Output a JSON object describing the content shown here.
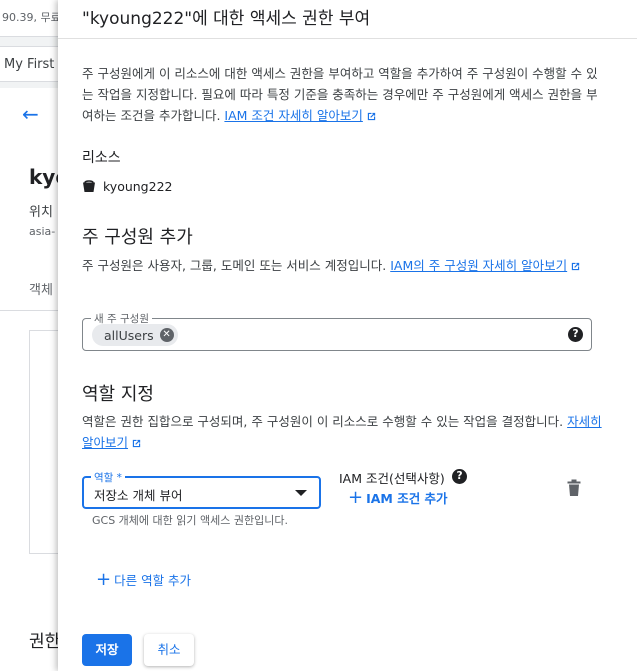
{
  "background": {
    "topbar_text": "90.39, 무료",
    "project_selector": "My First",
    "bucket_name": "kyo",
    "location_label": "위치",
    "location_value": "asia-",
    "objects_tab": "객체",
    "permissions_heading": "권한"
  },
  "panel": {
    "title": "\"kyoung222\"에 대한 액세스 권한 부여",
    "intro_text": "주 구성원에게 이 리소스에 대한 액세스 권한을 부여하고 역할을 추가하여 주 구성원이 수행할 수 있는 작업을 지정합니다. 필요에 따라 특정 기준을 충족하는 경우에만 주 구성원에게 액세스 권한을 부여하는 조건을 추가합니다.",
    "intro_link": "IAM 조건 자세히 알아보기",
    "resource": {
      "heading": "리소스",
      "name": "kyoung222",
      "icon": "bucket-icon"
    },
    "add_principals": {
      "heading": "주 구성원 추가",
      "description": "주 구성원은 사용자, 그룹, 도메인 또는 서비스 계정입니다.",
      "link": "IAM의 주 구성원 자세히 알아보기",
      "field_label": "새 주 구성원",
      "chips": [
        "allUsers"
      ]
    },
    "assign_roles": {
      "heading": "역할 지정",
      "description": "역할은 권한 집합으로 구성되며, 주 구성원이 이 리소스로 수행할 수 있는 작업을 결정합니다.",
      "link": "자세히 알아보기",
      "role_label": "역할 *",
      "role_value": "저장소 개체 뷰어",
      "role_hint": "GCS 개체에 대한 읽기 액세스 권한입니다.",
      "condition_title": "IAM 조건(선택사항)",
      "condition_add": "IAM 조건 추가",
      "add_role": "다른 역할 추가"
    },
    "actions": {
      "save": "저장",
      "cancel": "취소"
    },
    "colors": {
      "accent": "#1a73e8",
      "text": "#202124",
      "secondary": "#5f6368"
    }
  }
}
